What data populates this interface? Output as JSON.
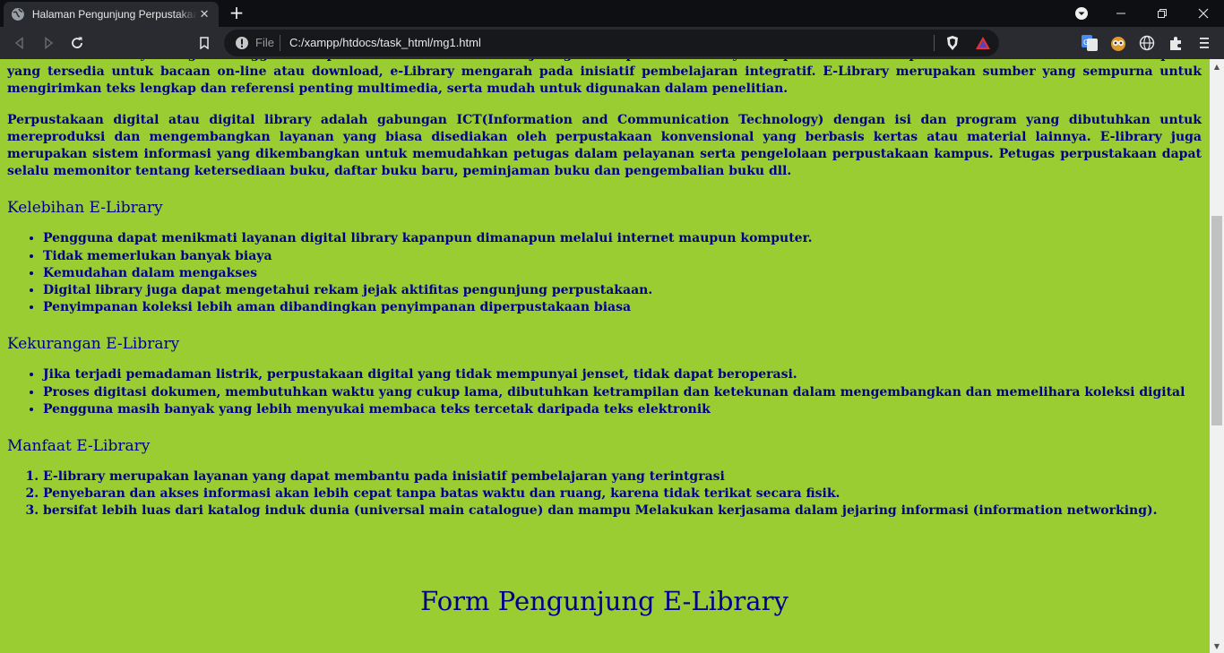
{
  "browser": {
    "tab_title": "Halaman Pengunjung Perpustakaan",
    "address_prefix": "File",
    "url": "C:/xampp/htdocs/task_html/mg1.html"
  },
  "page": {
    "paragraphs": [
      "mendistribusikannya dengan menggunakan protocol elektronik melalui jaringan komputer. E-Library merupakan suatu kumpulan/koleksi artikel-artikel dan laporan yang tersedia untuk bacaan on-line atau download, e-Library mengarah pada inisiatif pembelajaran integratif. E-Library merupakan sumber yang sempurna untuk mengirimkan teks lengkap dan referensi penting multimedia, serta mudah untuk digunakan dalam penelitian.",
      "Perpustakaan digital atau digital library adalah gabungan ICT(Information and Communication Technology) dengan isi dan program yang dibutuhkan untuk mereproduksi dan mengembangkan layanan yang biasa disediakan oleh perpustakaan konvensional yang berbasis kertas atau material lainnya. E-library juga merupakan sistem informasi yang dikembangkan untuk memudahkan petugas dalam pelayanan serta pengelolaan perpustakaan kampus. Petugas perpustakaan dapat selalu memonitor tentang ketersediaan buku, daftar buku baru, peminjaman buku dan pengembalian buku dll."
    ],
    "kelebihan": {
      "heading": "Kelebihan E-Library",
      "items": [
        "Pengguna dapat menikmati layanan digital library kapanpun dimanapun melalui internet maupun komputer.",
        "Tidak memerlukan banyak biaya",
        "Kemudahan dalam mengakses",
        "Digital library juga dapat mengetahui rekam jejak aktifitas pengunjung perpustakaan.",
        "Penyimpanan koleksi lebih aman dibandingkan penyimpanan diperpustakaan biasa"
      ]
    },
    "kekurangan": {
      "heading": "Kekurangan E-Library",
      "items": [
        "Jika terjadi pemadaman listrik, perpustakaan digital yang tidak mempunyai jenset, tidak dapat beroperasi.",
        "Proses digitasi dokumen, membutuhkan waktu yang cukup lama, dibutuhkan ketrampilan dan ketekunan dalam mengembangkan dan memelihara koleksi digital",
        "Pengguna masih banyak yang lebih menyukai membaca teks tercetak daripada teks elektronik"
      ]
    },
    "manfaat": {
      "heading": "Manfaat E-Library",
      "items": [
        "E-library merupakan layanan yang dapat membantu pada inisiatif pembelajaran yang terintgrasi",
        "Penyebaran dan akses informasi akan lebih cepat tanpa batas waktu dan ruang, karena tidak terikat secara fisik.",
        "bersifat lebih luas dari katalog induk dunia (universal main catalogue) dan mampu Melakukan kerjasama dalam jejaring informasi (information networking)."
      ]
    },
    "form_title": "Form Pengunjung E-Library"
  }
}
